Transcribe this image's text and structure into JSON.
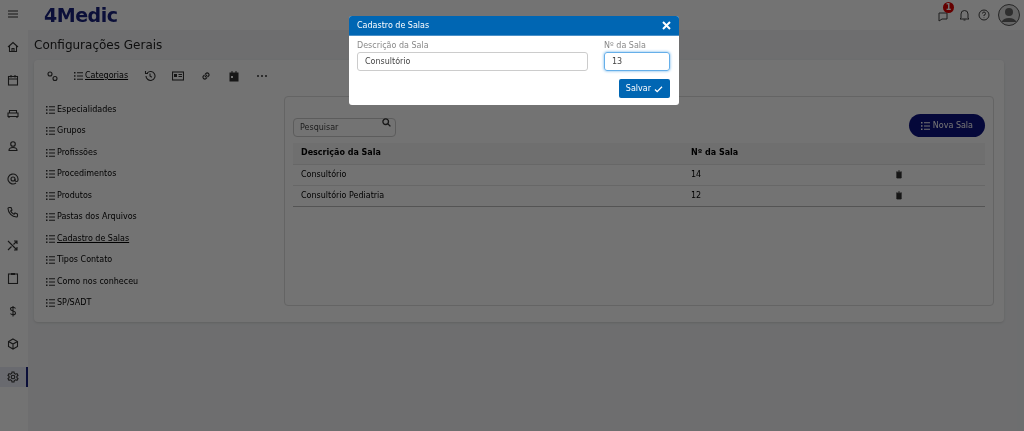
{
  "app": {
    "logo": "4Medic",
    "notification_badge": "1"
  },
  "sidebar": {
    "items": [
      {
        "selected": false
      },
      {
        "selected": false
      },
      {
        "selected": false
      },
      {
        "selected": false
      },
      {
        "selected": false
      },
      {
        "selected": false
      },
      {
        "selected": false
      },
      {
        "selected": false
      },
      {
        "selected": false
      },
      {
        "selected": false
      },
      {
        "selected": false
      },
      {
        "selected": true
      }
    ]
  },
  "page_title": "Configurações Gerais",
  "toolbar": [
    {
      "selected": false
    },
    {
      "label": "Categorias",
      "selected": true
    },
    {
      "selected": false
    },
    {
      "selected": false
    },
    {
      "selected": false
    },
    {
      "selected": false
    },
    {
      "selected": false
    }
  ],
  "categories": [
    {
      "label": "Especialidades",
      "selected": false
    },
    {
      "label": "Grupos",
      "selected": false
    },
    {
      "label": "Profissões",
      "selected": false
    },
    {
      "label": "Procedimentos",
      "selected": false
    },
    {
      "label": "Produtos",
      "selected": false
    },
    {
      "label": "Pastas dos Arquivos",
      "selected": false
    },
    {
      "label": "Cadastro de Salas",
      "selected": true
    },
    {
      "label": "Tipos Contato",
      "selected": false
    },
    {
      "label": "Como nos conheceu",
      "selected": false
    },
    {
      "label": "SP/SADT",
      "selected": false
    }
  ],
  "search": {
    "placeholder": "Pesquisar"
  },
  "new_button": "Nova Sala",
  "table": {
    "columns": [
      "Descrição da Sala",
      "Nº da Sala"
    ],
    "rows": [
      [
        "Consultório",
        "14"
      ],
      [
        "Consultório Pediatria",
        "12"
      ]
    ]
  },
  "dialog": {
    "title": "Cadastro de Salas",
    "fields": [
      {
        "label": "Descrição da Sala",
        "value": "Consultório",
        "focused": false
      },
      {
        "label": "Nº da Sala",
        "value": "13",
        "focused": true
      }
    ],
    "save_button": "Salvar"
  }
}
